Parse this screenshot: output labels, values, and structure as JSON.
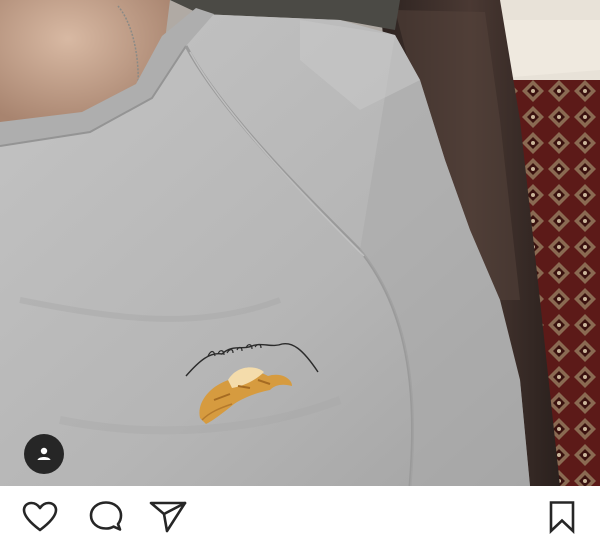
{
  "post": {
    "photo": {
      "subject": "grey-sweatshirt-with-embroidered-croissant",
      "embroidery_text": "mon amour",
      "colors": {
        "sweater": "#bdbdbd",
        "sweater_shadow": "#9e9e9e",
        "skin": "#c9a892",
        "leather": "#3a2c28",
        "rug_red": "#6b1f1c",
        "croissant": "#d49a3c"
      }
    },
    "user_tag": {
      "icon": "user-icon"
    },
    "actions": {
      "like": {
        "icon": "heart-icon"
      },
      "comment": {
        "icon": "comment-icon"
      },
      "share": {
        "icon": "paper-plane-icon"
      },
      "save": {
        "icon": "bookmark-icon"
      }
    }
  }
}
